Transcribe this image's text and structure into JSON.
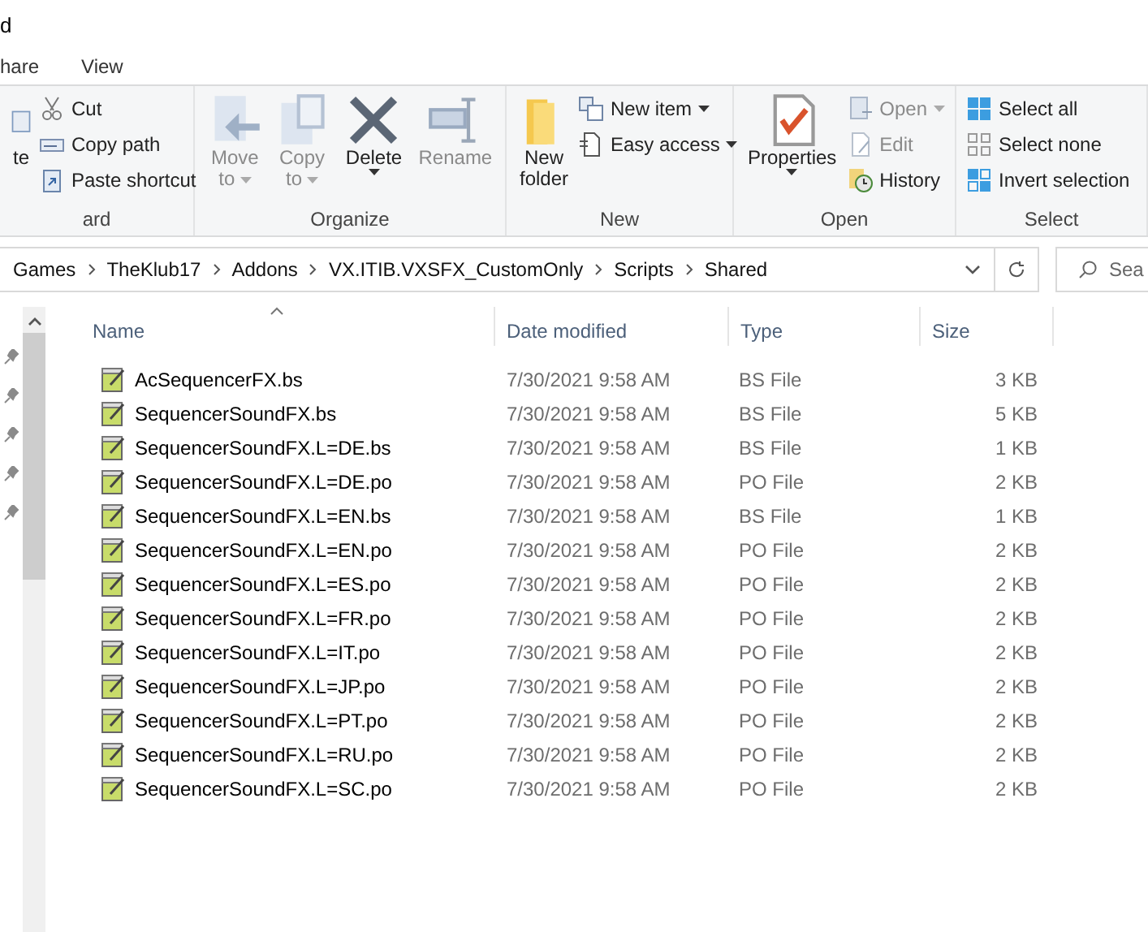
{
  "window": {
    "title": "d"
  },
  "tabs": [
    {
      "label": "hare",
      "selected": false
    },
    {
      "label": "View",
      "selected": false
    }
  ],
  "ribbon": {
    "groups": [
      {
        "label": "ard",
        "big": [
          {
            "kind": "paste",
            "lines": [
              "te"
            ],
            "disabled": false,
            "dropdown": false
          }
        ],
        "small": [
          {
            "kind": "cut",
            "label": "Cut",
            "disabled": false,
            "dropdown": false
          },
          {
            "kind": "copypath",
            "label": "Copy path",
            "disabled": false,
            "dropdown": false
          },
          {
            "kind": "pasteshortcut",
            "label": "Paste shortcut",
            "disabled": false,
            "dropdown": false
          }
        ]
      },
      {
        "label": "Organize",
        "big": [
          {
            "kind": "move",
            "lines": [
              "Move",
              "to"
            ],
            "disabled": true,
            "dropdown": true
          },
          {
            "kind": "copy",
            "lines": [
              "Copy",
              "to"
            ],
            "disabled": true,
            "dropdown": true
          },
          {
            "kind": "delete",
            "lines": [
              "Delete"
            ],
            "disabled": false,
            "dropdown": true
          },
          {
            "kind": "rename",
            "lines": [
              "Rename"
            ],
            "disabled": true,
            "dropdown": false
          }
        ]
      },
      {
        "label": "New",
        "big": [
          {
            "kind": "folder",
            "lines": [
              "New",
              "folder"
            ],
            "disabled": false,
            "dropdown": false
          }
        ],
        "small": [
          {
            "kind": "newitem",
            "label": "New item",
            "disabled": false,
            "dropdown": true
          },
          {
            "kind": "easyaccess",
            "label": "Easy access",
            "disabled": false,
            "dropdown": true
          }
        ]
      },
      {
        "label": "Open",
        "big": [
          {
            "kind": "properties",
            "lines": [
              "Properties"
            ],
            "disabled": false,
            "dropdown": true
          }
        ],
        "small": [
          {
            "kind": "open",
            "label": "Open",
            "disabled": true,
            "dropdown": true
          },
          {
            "kind": "edit",
            "label": "Edit",
            "disabled": true,
            "dropdown": false
          },
          {
            "kind": "history",
            "label": "History",
            "disabled": false,
            "dropdown": false
          }
        ]
      },
      {
        "label": "Select",
        "small": [
          {
            "kind": "selectall",
            "label": "Select all",
            "disabled": false,
            "dropdown": false
          },
          {
            "kind": "selectnone",
            "label": "Select none",
            "disabled": false,
            "dropdown": false
          },
          {
            "kind": "invert",
            "label": "Invert selection",
            "disabled": false,
            "dropdown": false
          }
        ]
      }
    ]
  },
  "address": {
    "path": [
      "Games",
      "TheKlub17",
      "Addons",
      "VX.ITIB.VXSFX_CustomOnly",
      "Scripts",
      "Shared"
    ]
  },
  "search": {
    "placeholder": "Sea"
  },
  "table": {
    "columns": [
      {
        "label": "Name",
        "sorted": true
      },
      {
        "label": "Date modified",
        "sorted": false
      },
      {
        "label": "Type",
        "sorted": false
      },
      {
        "label": "Size",
        "sorted": false
      }
    ],
    "rows": [
      {
        "name": "AcSequencerFX.bs",
        "date": "7/30/2021 9:58 AM",
        "type": "BS File",
        "size": "3 KB"
      },
      {
        "name": "SequencerSoundFX.bs",
        "date": "7/30/2021 9:58 AM",
        "type": "BS File",
        "size": "5 KB"
      },
      {
        "name": "SequencerSoundFX.L=DE.bs",
        "date": "7/30/2021 9:58 AM",
        "type": "BS File",
        "size": "1 KB"
      },
      {
        "name": "SequencerSoundFX.L=DE.po",
        "date": "7/30/2021 9:58 AM",
        "type": "PO File",
        "size": "2 KB"
      },
      {
        "name": "SequencerSoundFX.L=EN.bs",
        "date": "7/30/2021 9:58 AM",
        "type": "BS File",
        "size": "1 KB"
      },
      {
        "name": "SequencerSoundFX.L=EN.po",
        "date": "7/30/2021 9:58 AM",
        "type": "PO File",
        "size": "2 KB"
      },
      {
        "name": "SequencerSoundFX.L=ES.po",
        "date": "7/30/2021 9:58 AM",
        "type": "PO File",
        "size": "2 KB"
      },
      {
        "name": "SequencerSoundFX.L=FR.po",
        "date": "7/30/2021 9:58 AM",
        "type": "PO File",
        "size": "2 KB"
      },
      {
        "name": "SequencerSoundFX.L=IT.po",
        "date": "7/30/2021 9:58 AM",
        "type": "PO File",
        "size": "2 KB"
      },
      {
        "name": "SequencerSoundFX.L=JP.po",
        "date": "7/30/2021 9:58 AM",
        "type": "PO File",
        "size": "2 KB"
      },
      {
        "name": "SequencerSoundFX.L=PT.po",
        "date": "7/30/2021 9:58 AM",
        "type": "PO File",
        "size": "2 KB"
      },
      {
        "name": "SequencerSoundFX.L=RU.po",
        "date": "7/30/2021 9:58 AM",
        "type": "PO File",
        "size": "2 KB"
      },
      {
        "name": "SequencerSoundFX.L=SC.po",
        "date": "7/30/2021 9:58 AM",
        "type": "PO File",
        "size": "2 KB"
      }
    ]
  }
}
